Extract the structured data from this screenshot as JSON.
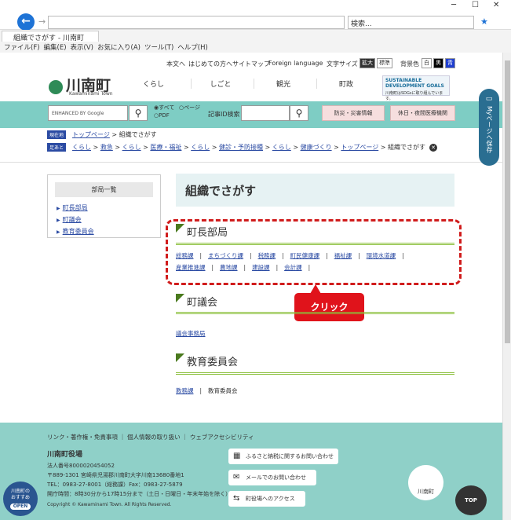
{
  "browser": {
    "search_placeholder": "検索...",
    "tab_title": "組織でさがす - 川南町",
    "menu": [
      "ファイル(F)",
      "編集(E)",
      "表示(V)",
      "お気に入り(A)",
      "ツール(T)",
      "ヘルプ(H)"
    ]
  },
  "header": {
    "site_name": "川南町",
    "site_sub": "Kawaminami Town",
    "util": [
      "本文へ",
      "はじめての方へ",
      "サイトマップ",
      "Foreign language"
    ],
    "text_size_label": "文字サイズ",
    "text_size_large": "拡大",
    "text_size_std": "標準",
    "bg_label": "背景色",
    "bg_white": "白",
    "bg_black": "黒",
    "bg_blue": "青",
    "nav": [
      "くらし",
      "しごと",
      "観光",
      "町政"
    ],
    "sdg_title": "SUSTAINABLE DEVELOPMENT GOALS",
    "sdg_text": "川南町はSDGsに取り組んでいます。"
  },
  "search": {
    "google_placeholder": "ENHANCED BY Google",
    "radio_all": "すべて",
    "radio_page": "ページ",
    "radio_pdf": "PDF",
    "id_label": "記事ID検索",
    "disaster": "防災・災害情報",
    "holiday": "休日・夜間医療機関"
  },
  "breadcrumb": {
    "current_tag": "現在地",
    "current_links": [
      "トップページ"
    ],
    "current_page": "組織でさがす",
    "history_tag": "足あと",
    "history_links": [
      "くらし",
      "救急",
      "くらし",
      "医療・福祉",
      "くらし",
      "健診・予防接種",
      "くらし",
      "健康づくり",
      "トップページ"
    ],
    "history_page": "組織でさがす"
  },
  "sidebar": {
    "title": "部局一覧",
    "items": [
      "町長部局",
      "町議会",
      "教育委員会"
    ]
  },
  "main": {
    "title": "組織でさがす",
    "sections": [
      {
        "heading": "町長部局",
        "row1": [
          "総務課",
          "まちづくり課",
          "税務課",
          "町民健康課",
          "福祉課",
          "環境水道課"
        ],
        "row2": [
          "産業推進課",
          "農地課",
          "建設課",
          "会計課"
        ]
      },
      {
        "heading": "町議会",
        "row1": [
          "議会事務局"
        ]
      },
      {
        "heading": "教育委員会",
        "row1": [
          "教務課",
          "教育委員会"
        ]
      }
    ]
  },
  "callout": "クリック",
  "mypage": "Myページへ保存",
  "footer": {
    "links": [
      "リンク・著作権・免責事項",
      "個人情報の取り扱い",
      "ウェブアクセシビリティ"
    ],
    "name": "川南町役場",
    "corp_no": "法人番号8000020454052",
    "address": "〒889-1301 宮崎県児湯郡川南町大字川南13680番地1",
    "tel": "TEL：0983-27-8001（総務課）Fax：0983-27-5879",
    "hours": "開庁時間：8時30分から17時15分まで（土日・日曜日・年末年始を除く）",
    "copyright": "Copyright © Kawaminami Town. All Rights Reserved.",
    "btn_furusato": "ふるさと納税に関するお問い合わせ",
    "btn_mail": "メールでのお問い合わせ",
    "btn_access": "町役場へのアクセス",
    "osusume1": "川南町の",
    "osusume2": "おすすめ",
    "osusume_open": "OPEN",
    "map_label": "川南町",
    "top": "TOP"
  }
}
